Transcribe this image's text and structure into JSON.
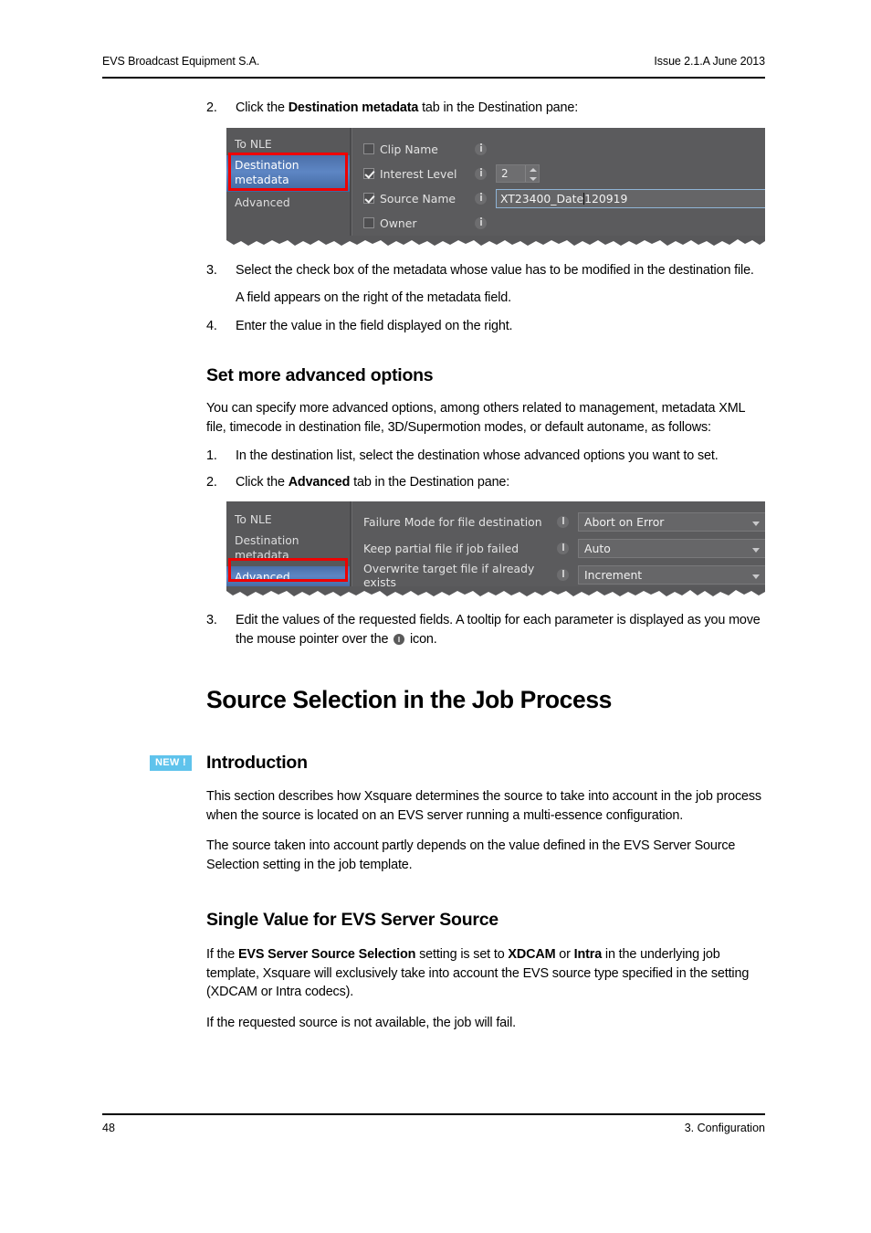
{
  "header": {
    "left": "EVS Broadcast Equipment S.A.",
    "right": "Issue 2.1.A June 2013"
  },
  "footer": {
    "page_number": "48",
    "chapter": "3. Configuration"
  },
  "steps_top": {
    "step2_num": "2.",
    "step2_pre": "Click the ",
    "step2_bold": "Destination metadata",
    "step2_post": " tab in the Destination pane:",
    "step3_num": "3.",
    "step3_text": "Select the check box of the metadata whose value has to be modified in the destination file.",
    "note_text": "A field appears on the right of the metadata field.",
    "step4_num": "4.",
    "step4_text": "Enter the value in the field displayed on the right."
  },
  "advanced_section": {
    "heading": "Set more advanced options",
    "intro": "You can specify more advanced options, among others related to management, metadata XML file, timecode in destination file, 3D/Supermotion modes, or default autoname, as follows:",
    "step1_num": "1.",
    "step1_text": "In the destination list, select the destination whose advanced options you want to set.",
    "step2_num": "2.",
    "step2_pre": "Click the ",
    "step2_bold": "Advanced",
    "step2_post": " tab in the Destination pane:",
    "step3_num": "3.",
    "step3_pre": "Edit the values of the requested fields. A tooltip for each parameter is displayed as you move the mouse pointer over the ",
    "step3_post": " icon."
  },
  "chapter_heading": "Source Selection in the Job Process",
  "introduction": {
    "badge": "NEW !",
    "badge_color": "#5fc3ec",
    "heading": "Introduction",
    "para1": "This section describes how Xsquare determines the source to take into account in the job process when the source is located on an EVS server running a multi-essence configuration.",
    "para2": "The source taken into account partly depends on the value defined in the EVS Server Source Selection setting in the job template."
  },
  "single_value": {
    "heading": "Single Value for EVS Server Source",
    "para1_a": "If the ",
    "para1_b": "EVS Server Source Selection",
    "para1_c": " setting is set to ",
    "para1_d": "XDCAM",
    "para1_e": " or ",
    "para1_f": "Intra",
    "para1_g": " in the underlying job template, Xsquare will exclusively take into account the EVS source type specified in the setting (XDCAM or Intra codecs).",
    "para2": "If the requested source is not available, the job will fail."
  },
  "screenshot_metadata": {
    "sidebar": {
      "tabs": [
        {
          "label": "To NLE",
          "selected": false
        },
        {
          "label": "Destination metadata",
          "selected": true,
          "highlighted": true
        },
        {
          "label": "Advanced",
          "selected": false
        }
      ]
    },
    "rows": [
      {
        "label": "Clip Name",
        "checked": false,
        "control": "none"
      },
      {
        "label": "Interest Level",
        "checked": true,
        "control": "spinner",
        "value": "2"
      },
      {
        "label": "Source Name",
        "checked": true,
        "control": "text",
        "value_before_caret": "XT23400_Date",
        "value_after_caret": "120919"
      },
      {
        "label": "Owner",
        "checked": false,
        "control": "none"
      }
    ],
    "highlight_color": "#ee0000"
  },
  "screenshot_advanced": {
    "sidebar": {
      "tabs": [
        {
          "label": "To NLE",
          "selected": false
        },
        {
          "label": "Destination metadata",
          "selected": false
        },
        {
          "label": "Advanced",
          "selected": true,
          "highlighted": true
        }
      ]
    },
    "rows": [
      {
        "label": "Failure Mode for file destination",
        "value": "Abort on Error"
      },
      {
        "label": "Keep partial file if job failed",
        "value": "Auto"
      },
      {
        "label": "Overwrite target file if already exists",
        "value": "Increment"
      }
    ],
    "highlight_color": "#ee0000"
  }
}
